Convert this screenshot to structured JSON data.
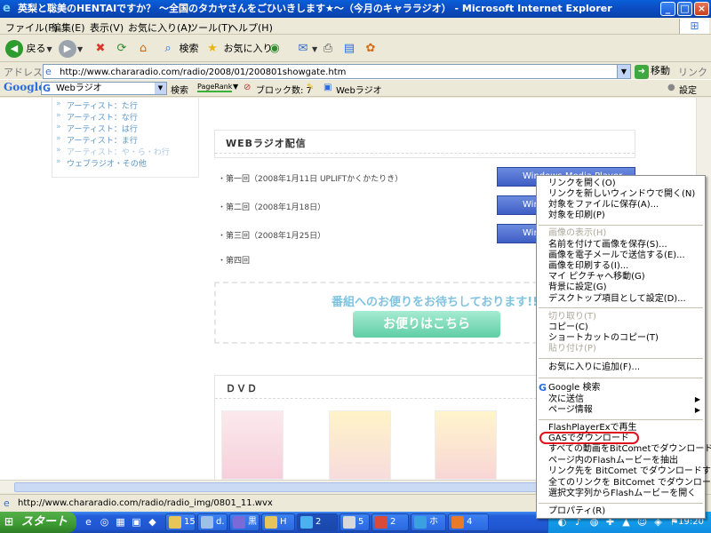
{
  "window": {
    "title": "英梨と聡美のHENTAIですか？ 〜全国のタカヤさんをごひいきします★〜（今月のキャララジオ） - Microsoft Internet Explorer",
    "controls": [
      "_",
      "□",
      "×"
    ]
  },
  "menubar": {
    "items": [
      "ファイル(F)",
      "編集(E)",
      "表示(V)",
      "お気に入り(A)",
      "ツール(T)",
      "ヘルプ(H)"
    ]
  },
  "toolbar": {
    "back": "戻る",
    "search": "検索",
    "favorites": "お気に入り"
  },
  "address": {
    "label": "アドレス(D)",
    "url": "http://www.chararadio.com/radio/2008/01/200801showgate.htm",
    "go": "移動",
    "links": "リンク"
  },
  "google_toolbar": {
    "logo": "Google",
    "search_value": "Webラジオ",
    "search_btn": "検索",
    "pagerank": "PageRank",
    "blocked": "ブロック数: 7",
    "web_radio": "Webラジオ",
    "settings": "設定"
  },
  "page": {
    "artists": [
      "アーティスト：た行",
      "アーティスト：な行",
      "アーティスト：は行",
      "アーティスト：ま行",
      "アーティスト：や・ら・わ行",
      "ウェブラジオ・その他"
    ],
    "webradio_title": "WEBラジオ配信",
    "episodes": [
      {
        "label": "第一回（2008年1月11日 UPLIFTかくかたりき）",
        "button": "Windows Media Player"
      },
      {
        "label": "第二回（2008年1月18日）",
        "button": "Windows Media Player"
      },
      {
        "label": "第三回（2008年1月25日）",
        "button": "Windows Media Player"
      },
      {
        "label": "第四回",
        "button": ""
      }
    ],
    "mail_text": "番組へのお便りをお待ちしております!!",
    "mail_button": "お便りはこちら",
    "dvd_title": "ＤＶＤ"
  },
  "context_menu": {
    "items": [
      {
        "label": "リンクを開く(O)",
        "disabled": false
      },
      {
        "label": "リンクを新しいウィンドウで開く(N)",
        "disabled": false
      },
      {
        "label": "対象をファイルに保存(A)...",
        "disabled": false
      },
      {
        "label": "対象を印刷(P)",
        "disabled": false
      },
      {
        "label": "画像の表示(H)",
        "disabled": true
      },
      {
        "label": "名前を付けて画像を保存(S)...",
        "disabled": false
      },
      {
        "label": "画像を電子メールで送信する(E)...",
        "disabled": false
      },
      {
        "label": "画像を印刷する(I)...",
        "disabled": false
      },
      {
        "label": "マイ ピクチャへ移動(G)",
        "disabled": false
      },
      {
        "label": "背景に設定(G)",
        "disabled": false
      },
      {
        "label": "デスクトップ項目として設定(D)...",
        "disabled": false
      },
      {
        "label": "切り取り(T)",
        "disabled": true
      },
      {
        "label": "コピー(C)",
        "disabled": false
      },
      {
        "label": "ショートカットのコピー(T)",
        "disabled": false
      },
      {
        "label": "貼り付け(P)",
        "disabled": true
      },
      {
        "label": "お気に入りに追加(F)...",
        "disabled": false
      },
      {
        "label": "Google 検索",
        "disabled": false
      },
      {
        "label": "次に送信",
        "disabled": false
      },
      {
        "label": "ページ情報",
        "disabled": false
      },
      {
        "label": "FlashPlayerExで再生",
        "disabled": false
      },
      {
        "label": "GASでダウンロード",
        "disabled": false
      },
      {
        "label": "すべての動画をBitCometでダウンロード",
        "disabled": false
      },
      {
        "label": "ページ内のFlashムービーを抽出",
        "disabled": false
      },
      {
        "label": "リンク先を BitComet でダウンロードする",
        "disabled": false
      },
      {
        "label": "全てのリンクを BitComet でダウンロードする",
        "disabled": false
      },
      {
        "label": "選択文字列からFlashムービーを開く",
        "disabled": false
      },
      {
        "label": "プロパティ(R)",
        "disabled": false
      }
    ]
  },
  "status_bar": {
    "text": "http://www.chararadio.com/radio/radio_img/0801_11.wvx"
  },
  "taskbar": {
    "start": "スタート",
    "tasks": [
      "15",
      "d.",
      "黒",
      "H",
      "2",
      "5",
      "2",
      "ホ",
      "4"
    ],
    "clock": "19:20"
  },
  "colors": {
    "titlebar": "#0b4fc6",
    "highlight_ring": "#e0101c",
    "taskbar": "#245edb",
    "start_button": "#3d9a32"
  }
}
